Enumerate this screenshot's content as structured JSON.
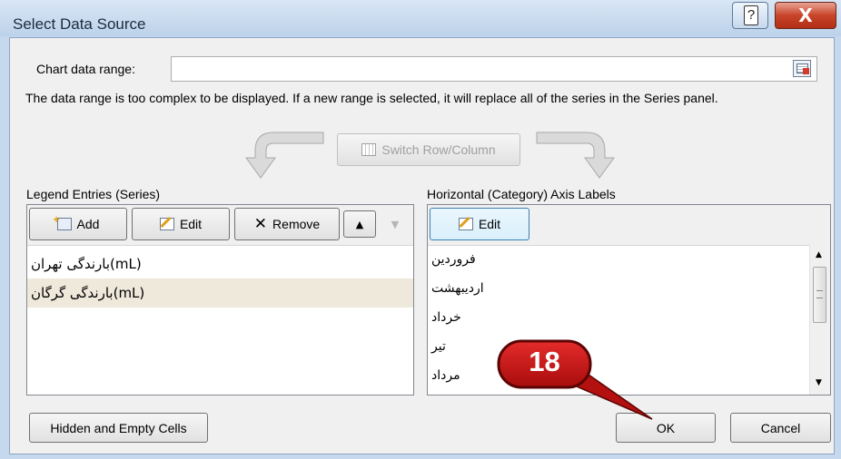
{
  "window": {
    "title": "Select Data Source",
    "help_glyph": "?",
    "close_glyph": "X"
  },
  "data_range": {
    "label": "Chart data range:",
    "value": "",
    "message": "The data range is too complex to be displayed. If a new range is selected, it will replace all of the series in the Series panel."
  },
  "switch_button": {
    "label": "Switch Row/Column"
  },
  "legend": {
    "header": "Legend Entries (Series)",
    "buttons": {
      "add": "Add",
      "edit": "Edit",
      "remove": "Remove"
    },
    "items": [
      {
        "label": "بارندگی تهران(mL)",
        "selected": false
      },
      {
        "label": "بارندگی گرگان(mL)",
        "selected": true
      }
    ]
  },
  "axis": {
    "header": "Horizontal (Category) Axis Labels",
    "edit_button": "Edit",
    "items": [
      "فروردین",
      "اردیبهشت",
      "خرداد",
      "تیر",
      "مرداد"
    ]
  },
  "footer": {
    "hidden_empty": "Hidden and Empty Cells",
    "ok": "OK",
    "cancel": "Cancel"
  },
  "callout": {
    "number": "18",
    "color": "#cc1414"
  },
  "colors": {
    "title_bar": "#c5d8ee",
    "selected_row": "#efe9dc",
    "close_button": "#c8442a"
  }
}
